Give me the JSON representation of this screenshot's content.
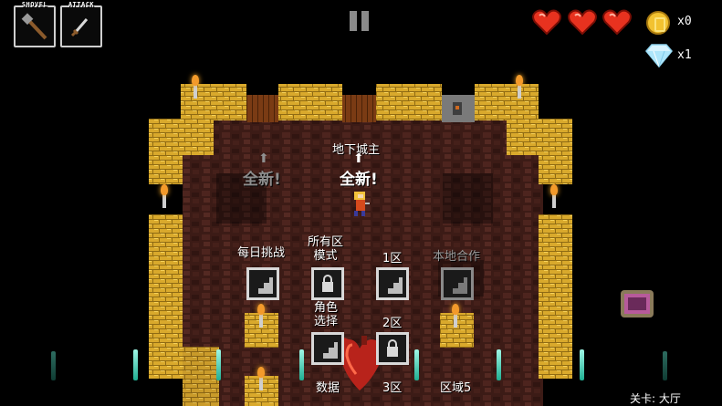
{
  "hud": {
    "shovel_label": "SHOVEL",
    "attack_label": "ATTACK",
    "coin_count": "x0",
    "diamond_count": "x1",
    "hearts": 3
  },
  "lobby": {
    "label_dungeon_master": "地下城主",
    "label_new_left": "全新!",
    "label_new_center": "全新!",
    "label_daily": "每日挑战",
    "label_all_zones": "所有区\n模式",
    "label_zone1": "1区",
    "label_local_coop": "本地合作",
    "label_char_select": "角色\n选择",
    "label_zone2": "2区",
    "label_stats": "数据",
    "label_zone3": "3区",
    "label_zone4": "区域5"
  },
  "footer": {
    "level_text": "关卡: 大厅"
  },
  "colors": {
    "gold_wall": "#e0b331",
    "floor": "#5a2a22",
    "heart": "#e8321f",
    "crystal": "#6ff0d2"
  }
}
